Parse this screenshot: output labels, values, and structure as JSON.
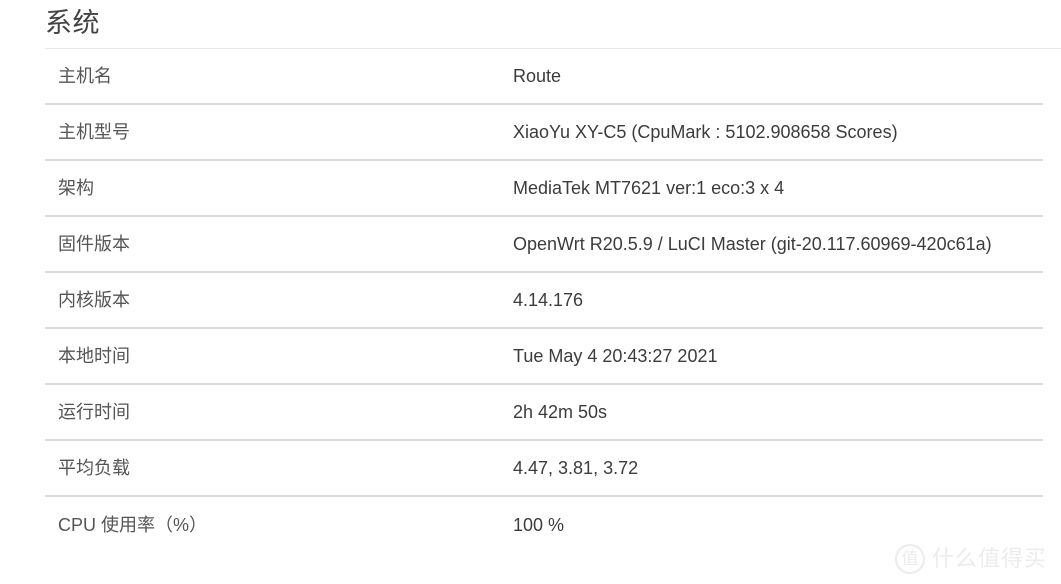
{
  "page": {
    "title": "系统",
    "background_color": "#ffffff",
    "text_color": "#3c3c3c",
    "label_color": "#555555",
    "separator_color": "#dcdcdc"
  },
  "system_info": {
    "rows": [
      {
        "label": "主机名",
        "value": "Route"
      },
      {
        "label": "主机型号",
        "value": "XiaoYu XY-C5 (CpuMark : 5102.908658 Scores)"
      },
      {
        "label": "架构",
        "value": "MediaTek MT7621 ver:1 eco:3 x 4"
      },
      {
        "label": "固件版本",
        "value": "OpenWrt R20.5.9 / LuCI Master (git-20.117.60969-420c61a)"
      },
      {
        "label": "内核版本",
        "value": "4.14.176"
      },
      {
        "label": "本地时间",
        "value": "Tue May 4 20:43:27 2021"
      },
      {
        "label": "运行时间",
        "value": "2h 42m 50s"
      },
      {
        "label": "平均负载",
        "value": "4.47, 3.81, 3.72"
      },
      {
        "label": "CPU 使用率（%）",
        "value": "100 %"
      }
    ]
  },
  "watermark": {
    "mark": "值",
    "text": "什么值得买"
  }
}
